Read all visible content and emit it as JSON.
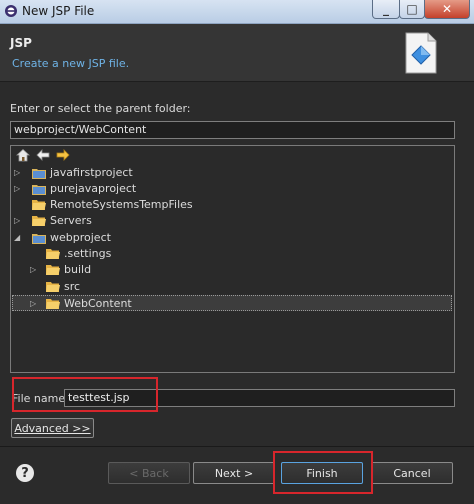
{
  "window": {
    "title": "New JSP File",
    "minimize": "_",
    "maximize": "□",
    "close": "✕"
  },
  "header": {
    "title": "JSP",
    "message": "Create a new JSP file."
  },
  "folder": {
    "label": "Enter or select the parent folder:",
    "value": "webproject/WebContent"
  },
  "tree": {
    "items": [
      {
        "label": "javafirstproject",
        "icon": "project-icon",
        "expander": "collapsed"
      },
      {
        "label": "purejavaproject",
        "icon": "project-icon",
        "expander": "collapsed"
      },
      {
        "label": "RemoteSystemsTempFiles",
        "icon": "folder-icon",
        "expander": "none"
      },
      {
        "label": "Servers",
        "icon": "folder-icon",
        "expander": "collapsed"
      },
      {
        "label": "webproject",
        "icon": "project-icon",
        "expander": "expanded"
      },
      {
        "label": ".settings",
        "icon": "folder-icon",
        "expander": "none"
      },
      {
        "label": "build",
        "icon": "folder-icon",
        "expander": "collapsed"
      },
      {
        "label": "src",
        "icon": "folder-icon",
        "expander": "none"
      },
      {
        "label": "WebContent",
        "icon": "folder-icon",
        "expander": "collapsed",
        "selected": true
      }
    ]
  },
  "filename": {
    "label": "File name:",
    "value": "testtest.jsp"
  },
  "buttons": {
    "advanced": "Advanced >>",
    "help": "?",
    "back": "< Back",
    "next": "Next >",
    "finish": "Finish",
    "cancel": "Cancel"
  },
  "colors": {
    "highlight": "#d7262c",
    "header_message": "#6fb3e6"
  }
}
